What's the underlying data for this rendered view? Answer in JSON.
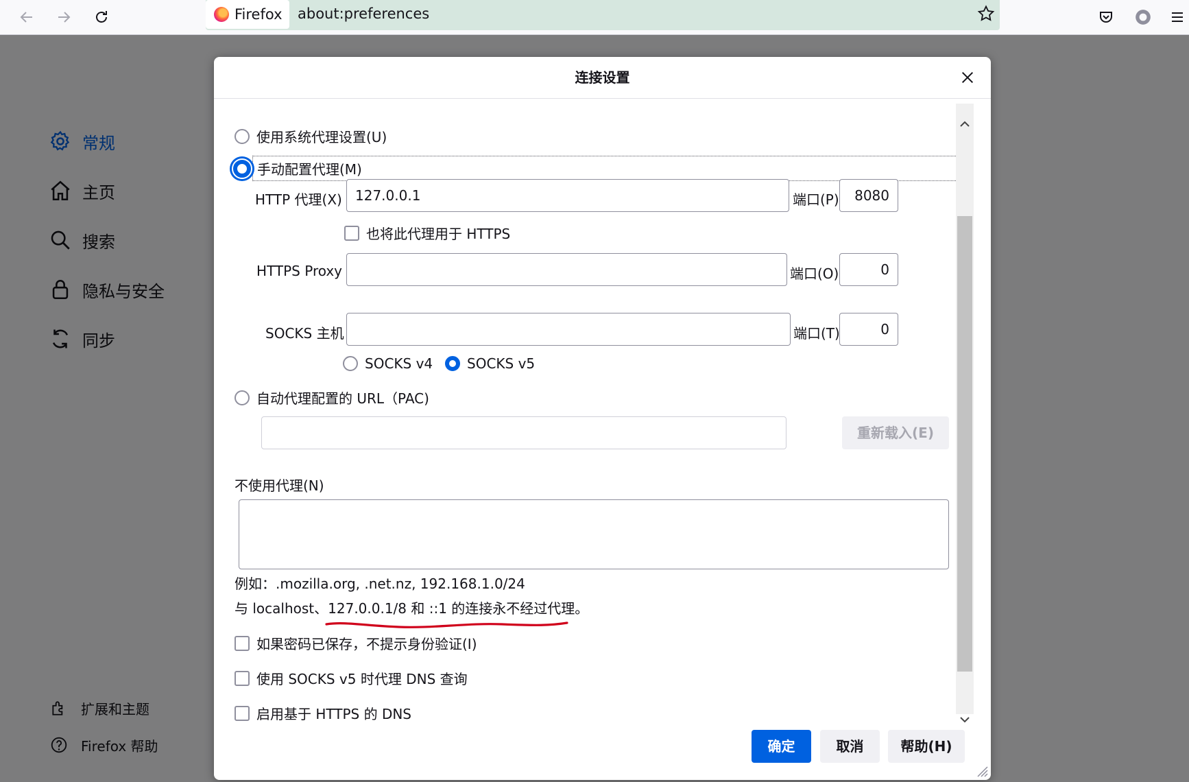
{
  "browser": {
    "identity_label": "Firefox",
    "url": "about:preferences"
  },
  "prefs_nav": {
    "items": [
      {
        "label": "常规",
        "icon": "gear-icon",
        "active": true
      },
      {
        "label": "主页",
        "icon": "home-icon"
      },
      {
        "label": "搜索",
        "icon": "search-icon"
      },
      {
        "label": "隐私与安全",
        "icon": "lock-icon"
      },
      {
        "label": "同步",
        "icon": "sync-icon"
      }
    ],
    "bottom": [
      {
        "label": "扩展和主题",
        "icon": "puzzle-icon"
      },
      {
        "label": "Firefox 帮助",
        "icon": "help-icon"
      }
    ]
  },
  "dialog": {
    "title": "连接设置",
    "options": {
      "system_proxy": "使用系统代理设置(U)",
      "manual_proxy": "手动配置代理(M)",
      "auto_pac": "自动代理配置的 URL（PAC)"
    },
    "http_proxy": {
      "label": "HTTP 代理(X)",
      "value": "127.0.0.1",
      "port_label": "端口(P)",
      "port": "8080"
    },
    "also_https": "也将此代理用于 HTTPS",
    "https_proxy": {
      "label": "HTTPS Proxy",
      "value": "",
      "port_label": "端口(O)",
      "port": "0"
    },
    "socks": {
      "label": "SOCKS 主机",
      "value": "",
      "port_label": "端口(T)",
      "port": "0",
      "v4": "SOCKS v4",
      "v5": "SOCKS v5",
      "selected": "v5"
    },
    "reload_button": "重新载入(E)",
    "no_proxy_label": "不使用代理(N)",
    "no_proxy_value": "",
    "example_text": "例如：.mozilla.org, .net.nz, 192.168.1.0/24",
    "localhost_note_prefix": "与 localhost、",
    "localhost_note_underlined": "127.0.0.1/8 和 ::1 的连接永不经过代理",
    "localhost_note_suffix": "。",
    "checkbox_no_auth": "如果密码已保存，不提示身份验证(I)",
    "checkbox_socks_dns": "使用 SOCKS v5 时代理 DNS 查询",
    "checkbox_doh": "启用基于 HTTPS 的 DNS",
    "ok_button": "确定",
    "cancel_button": "取消",
    "help_button": "帮助(H)"
  },
  "colors": {
    "accent": "#0061e0",
    "annotation": "#d0021b"
  }
}
